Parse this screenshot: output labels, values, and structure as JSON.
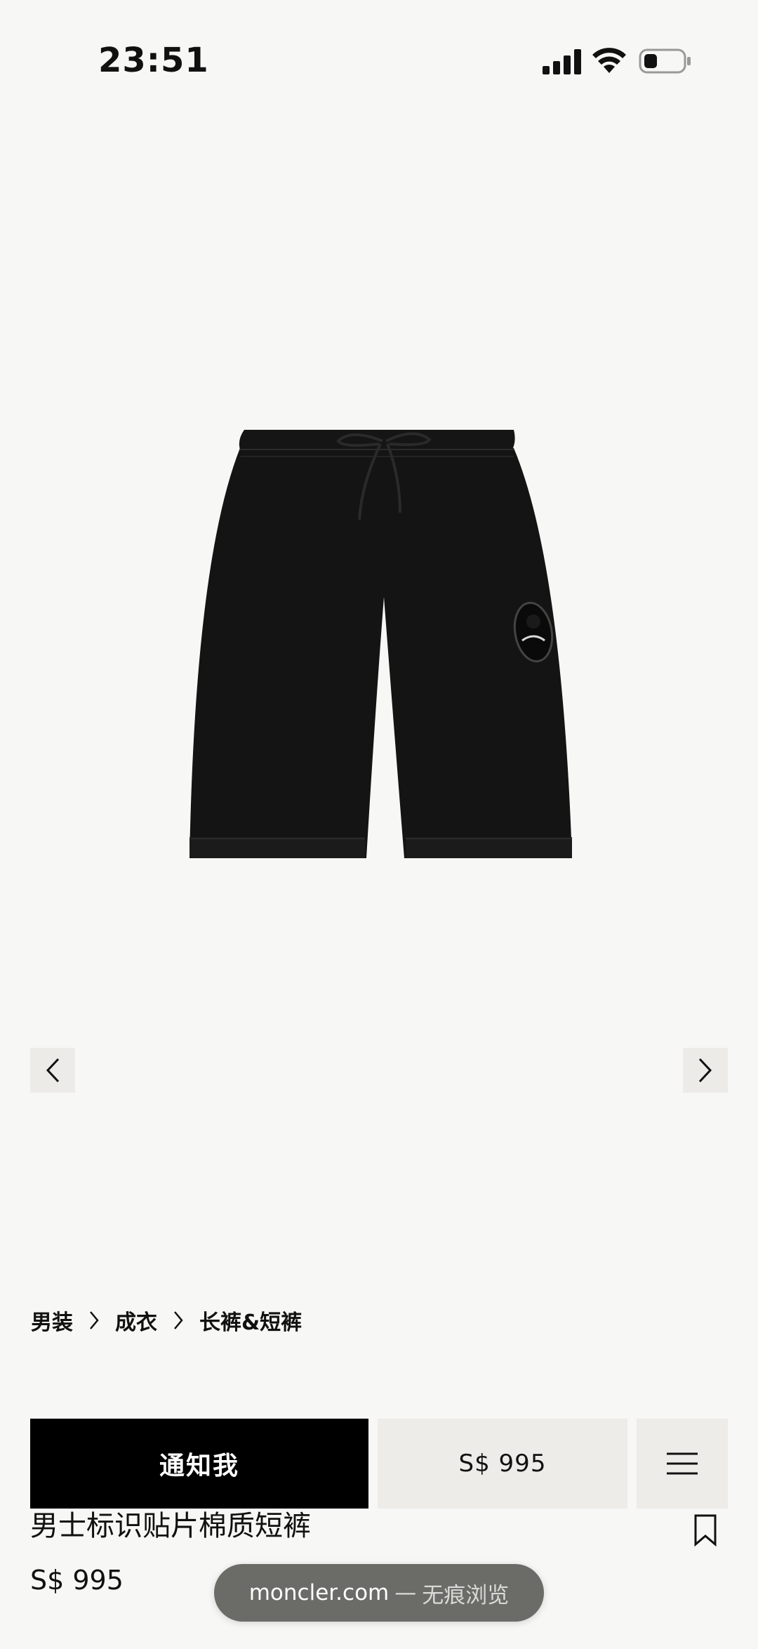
{
  "status_bar": {
    "time": "23:51"
  },
  "breadcrumb": [
    {
      "label": "男装"
    },
    {
      "label": "成衣"
    },
    {
      "label": "长裤&短裤"
    }
  ],
  "product": {
    "title": "男士标识贴片棉质短裤",
    "price": "S$ 995",
    "image_alt_icon": "shorts-image"
  },
  "action_bar": {
    "notify_label": "通知我",
    "price_label": "S$ 995"
  },
  "browser": {
    "domain": "moncler.com",
    "separator": "—",
    "mode": "无痕浏览"
  },
  "colors": {
    "background": "#f7f7f5",
    "notify_button": "#000000",
    "secondary_box": "#eeece8",
    "url_pill": "#6b6b68"
  }
}
